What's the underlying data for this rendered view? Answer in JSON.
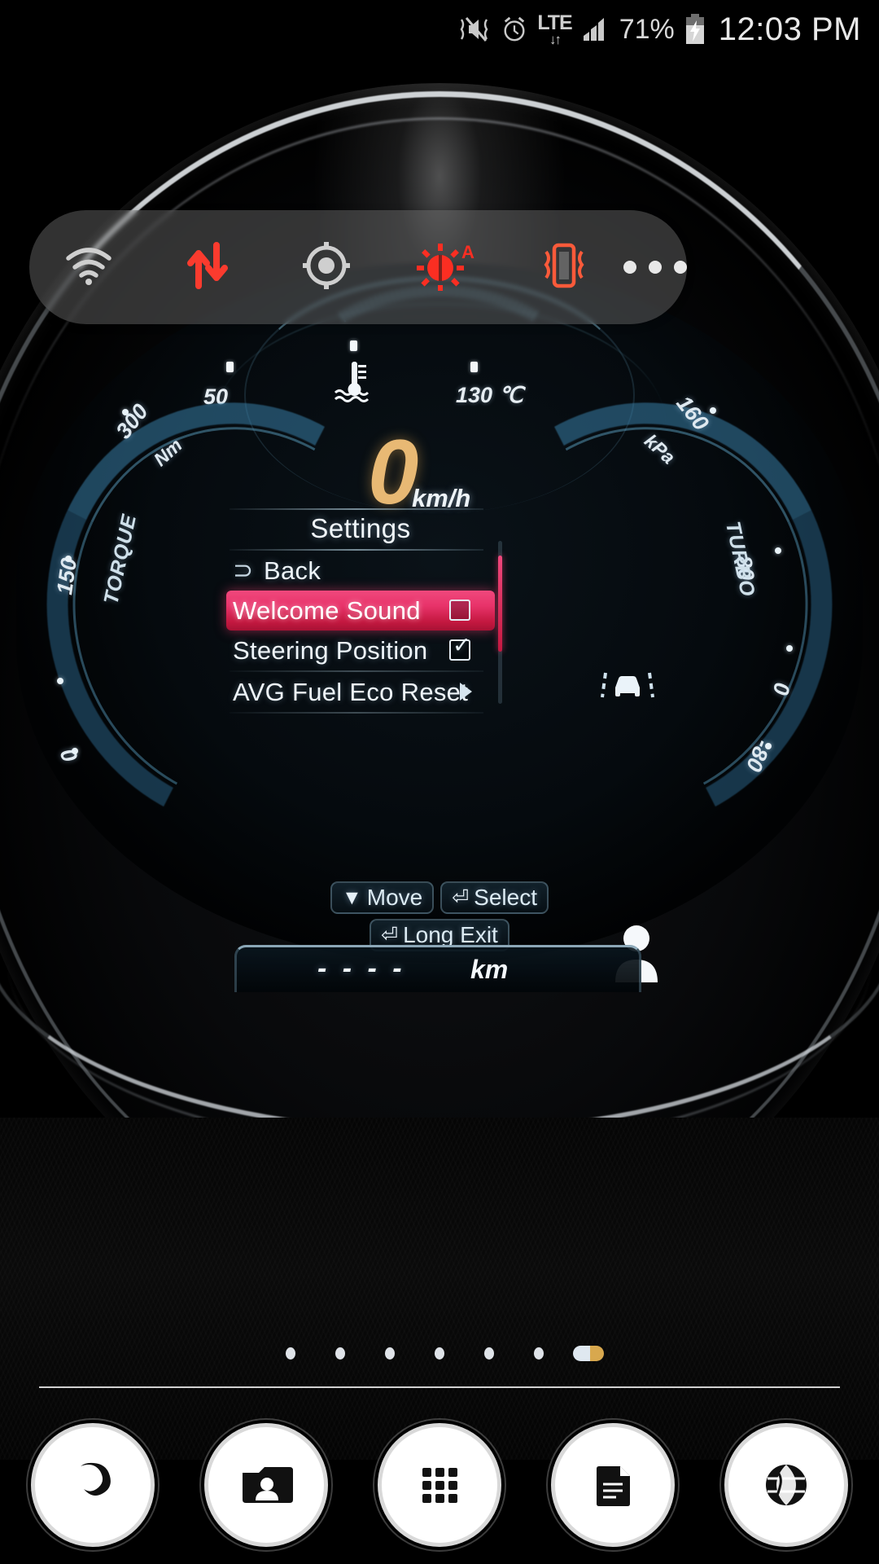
{
  "statusbar": {
    "icons": [
      "vibrate-mute-icon",
      "alarm-icon",
      "lte-icon",
      "signal-bars-icon",
      "battery-charging-icon"
    ],
    "lte_label": "LTE",
    "lte_arrows": "↓↑",
    "battery_percent": "71%",
    "clock": "12:03 PM"
  },
  "quick_settings": {
    "items": [
      {
        "name": "wifi-icon",
        "label": "Wi-Fi",
        "state": "off"
      },
      {
        "name": "data-transfer-icon",
        "label": "Mobile data",
        "state": "on"
      },
      {
        "name": "location-icon",
        "label": "Location",
        "state": "off"
      },
      {
        "name": "auto-brightness-icon",
        "label": "Auto brightness",
        "state": "on",
        "badge": "A"
      },
      {
        "name": "vibrate-icon",
        "label": "Vibrate",
        "state": "on"
      }
    ],
    "more_label": "More options"
  },
  "cluster": {
    "temperature_gauge": {
      "min_label": "50",
      "max_label": "130 ℃",
      "icon": "coolant-temp-icon"
    },
    "speed": {
      "value": "0",
      "unit": "km/h"
    },
    "torque_gauge": {
      "title": "TORQUE",
      "unit": "Nm",
      "ticks": [
        "0",
        "150",
        "300"
      ]
    },
    "turbo_gauge": {
      "title": "TURBO",
      "unit": "kPa",
      "ticks": [
        "-80",
        "0",
        "80",
        "160"
      ]
    },
    "menu": {
      "title": "Settings",
      "rows": [
        {
          "label": "Back",
          "icon": "back-arrow-icon",
          "control": "none",
          "selected": false
        },
        {
          "label": "Welcome Sound",
          "icon": "",
          "control": "checkbox",
          "checked": false,
          "selected": true
        },
        {
          "label": "Steering Position",
          "icon": "",
          "control": "checkbox",
          "checked": true,
          "selected": false
        },
        {
          "label": "AVG Fuel Eco Reset",
          "icon": "",
          "control": "arrow",
          "selected": false
        }
      ],
      "softkeys": [
        {
          "glyph": "▼",
          "label": "Move"
        },
        {
          "glyph": "⏎",
          "label": "Select"
        },
        {
          "glyph": "⏎",
          "label": "Long Exit"
        }
      ]
    },
    "odometer": {
      "value": "- - - -",
      "unit": "km"
    },
    "side_icons": [
      "lane-assist-icon",
      "driver-profile-icon"
    ]
  },
  "home": {
    "page_count": 7,
    "active_page": 7
  },
  "dock": {
    "items": [
      {
        "name": "phone-icon",
        "label": "Phone"
      },
      {
        "name": "contacts-icon",
        "label": "Contacts"
      },
      {
        "name": "apps-grid-icon",
        "label": "Apps"
      },
      {
        "name": "messages-icon",
        "label": "Messages"
      },
      {
        "name": "browser-icon",
        "label": "Internet"
      }
    ]
  },
  "colors": {
    "accent_red": "#e8336a",
    "speed_amber": "#e8b974",
    "gauge_blue": "#4f9fc8",
    "panel_grey": "#787878"
  }
}
